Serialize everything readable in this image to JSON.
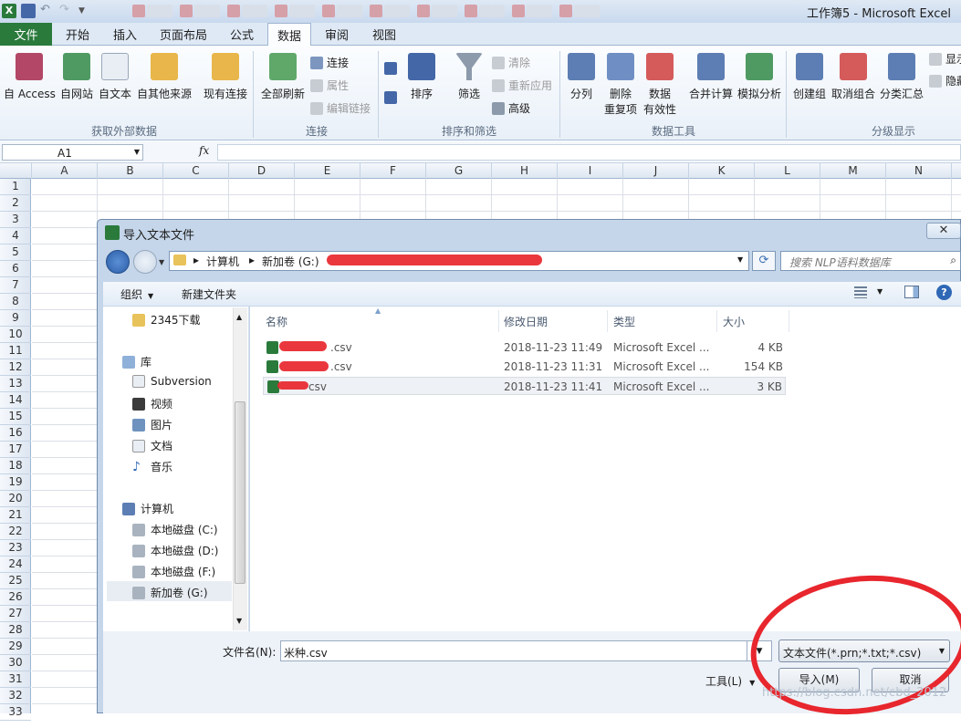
{
  "titlebar": {
    "title": "工作簿5  -  Microsoft Excel"
  },
  "tabs": [
    {
      "label": "文件"
    },
    {
      "label": "开始"
    },
    {
      "label": "插入"
    },
    {
      "label": "页面布局"
    },
    {
      "label": "公式"
    },
    {
      "label": "数据"
    },
    {
      "label": "审阅"
    },
    {
      "label": "视图"
    }
  ],
  "ribbon": {
    "external": {
      "access": "自 Access",
      "web": "自网站",
      "text": "自文本",
      "other": "自其他来源",
      "existing": "现有连接",
      "group": "获取外部数据"
    },
    "connections": {
      "refresh_all": "全部刷新",
      "connections": "连接",
      "properties": "属性",
      "edit_links": "编辑链接",
      "group": "连接"
    },
    "sort": {
      "sort": "排序",
      "filter": "筛选",
      "clear": "清除",
      "reapply": "重新应用",
      "advanced": "高级",
      "group": "排序和筛选"
    },
    "tools": {
      "split": "分列",
      "remove1": "删除",
      "remove2": "重复项",
      "valid1": "数据",
      "valid2": "有效性",
      "consolidate": "合并计算",
      "whatif": "模拟分析",
      "group": "数据工具"
    },
    "outline": {
      "group_btn": "创建组",
      "ungroup": "取消组合",
      "subtotal": "分类汇总",
      "show": "显示",
      "hide": "隐藏",
      "group": "分级显示"
    }
  },
  "formula_bar": {
    "cell": "A1",
    "fx": "fx"
  },
  "columns": [
    "A",
    "B",
    "C",
    "D",
    "E",
    "F",
    "G",
    "H",
    "I",
    "J",
    "K",
    "L",
    "M",
    "N"
  ],
  "rows": [
    "1",
    "2",
    "3",
    "4",
    "5",
    "6",
    "7",
    "8",
    "9",
    "10",
    "11",
    "12",
    "13",
    "14",
    "15",
    "16",
    "17",
    "18",
    "19",
    "20",
    "21",
    "22",
    "23",
    "24",
    "25",
    "26",
    "27",
    "28",
    "29",
    "30",
    "31",
    "32",
    "33"
  ],
  "dialog": {
    "title": "导入文本文件",
    "close": "✕",
    "breadcrumb": [
      "计算机",
      "新加卷 (G:)"
    ],
    "search_placeholder": "搜索 NLP语料数据库",
    "organize": "组织",
    "new_folder": "新建文件夹",
    "nav": {
      "downloads": "2345下载",
      "libraries": "库",
      "subversion": "Subversion",
      "videos": "视频",
      "pictures": "图片",
      "documents": "文档",
      "music": "音乐",
      "computer": "计算机",
      "drive_c": "本地磁盘 (C:)",
      "drive_d": "本地磁盘 (D:)",
      "drive_f": "本地磁盘 (F:)",
      "drive_g": "新加卷 (G:)"
    },
    "columns": {
      "name": "名称",
      "date": "修改日期",
      "type": "类型",
      "size": "大小"
    },
    "files": [
      {
        "name": ".csv",
        "date": "2018-11-23 11:49",
        "type": "Microsoft Excel ...",
        "size": "4 KB"
      },
      {
        "name": ".csv",
        "date": "2018-11-23 11:31",
        "type": "Microsoft Excel ...",
        "size": "154 KB"
      },
      {
        "name": "csv",
        "date": "2018-11-23 11:41",
        "type": "Microsoft Excel ...",
        "size": "3 KB"
      }
    ],
    "filename_label": "文件名(N):",
    "filename_value": "米种.csv",
    "filetype": "文本文件(*.prn;*.txt;*.csv)",
    "tools": "工具(L)",
    "import_btn": "导入(M)",
    "cancel_btn": "取消"
  },
  "watermark": "https://blog.csdn.net/cbd_2012"
}
